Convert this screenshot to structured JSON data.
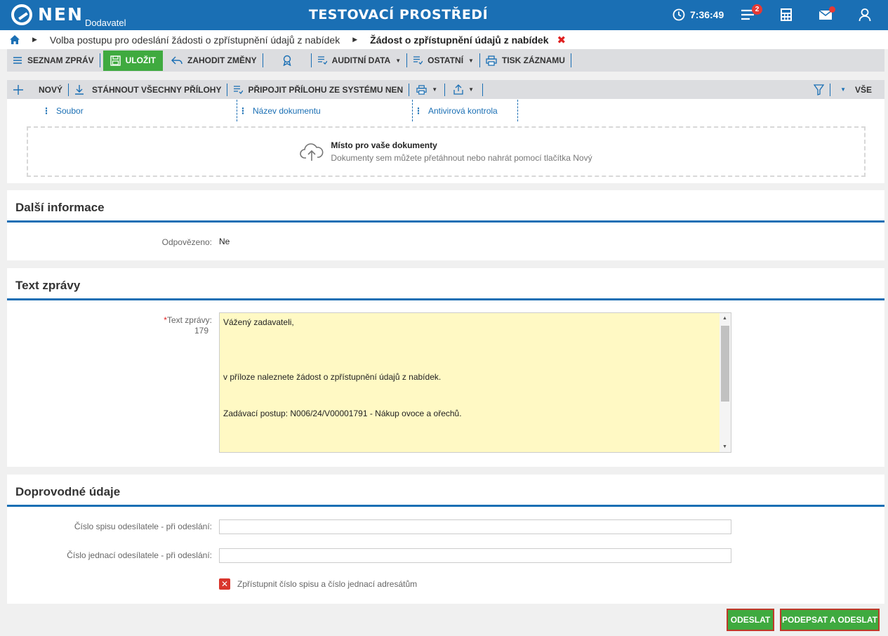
{
  "header": {
    "logo_text": "NEN",
    "logo_sub": "Dodavatel",
    "environment": "TESTOVACÍ PROSTŘEDÍ",
    "time": "7:36:49",
    "tasks_badge": "2",
    "icons": [
      "clock-icon",
      "tasks-icon",
      "calculator-icon",
      "mail-icon",
      "user-icon"
    ]
  },
  "breadcrumb": {
    "home_icon": "home-icon",
    "step1": "Volba postupu pro odeslání žádosti o zpřístupnění údajů z nabídek",
    "current": "Žádost o zpřístupnění údajů z nabídek",
    "close": "✖"
  },
  "toolbar": {
    "list": "SEZNAM ZPRÁV",
    "save": "ULOŽIT",
    "discard": "ZAHODIT ZMĚNY",
    "audit": "AUDITNÍ DATA",
    "other": "OSTATNÍ",
    "print": "TISK ZÁZNAMU"
  },
  "attachments": {
    "new": "NOVÝ",
    "download_all": "STÁHNOUT VŠECHNY PŘÍLOHY",
    "attach_system": "PŘIPOJIT PŘÍLOHU ZE SYSTÉMU NEN",
    "filter_all": "VŠE",
    "columns": [
      "Soubor",
      "Název dokumentu",
      "Antivirová kontrola"
    ],
    "dropzone_title": "Místo pro vaše dokumenty",
    "dropzone_sub": "Dokumenty sem můžete přetáhnout nebo nahrát pomocí tlačítka Nový"
  },
  "info_section": {
    "title": "Další informace",
    "answered_label": "Odpovězeno:",
    "answered_value": "Ne"
  },
  "message_section": {
    "title": "Text zprávy",
    "label": "Text zprávy:",
    "required_mark": "*",
    "char_count": "179",
    "lines": [
      "Vážený zadavateli,",
      "",
      "",
      "v příloze naleznete žádost o zpřístupnění údajů z nabídek.",
      "",
      "Zadávací postup: N006/24/V00001791 - Nákup ovoce a ořechů."
    ]
  },
  "extra_section": {
    "title": "Doprovodné údaje",
    "file_no_label": "Číslo spisu odesílatele - při odeslání:",
    "file_no_value": "",
    "ref_no_label": "Číslo jednací odesílatele - při odeslání:",
    "ref_no_value": "",
    "disclose_label": "Zpřístupnit číslo spisu a číslo jednací adresátům",
    "disclose_checked": false
  },
  "actions": {
    "send": "ODESLAT",
    "sign_send": "PODEPSAT A ODESLAT"
  },
  "colors": {
    "primary": "#1a6fb4",
    "save_green": "#3faa3f",
    "alert_red": "#e53935",
    "textarea_bg": "#fff9c4"
  }
}
